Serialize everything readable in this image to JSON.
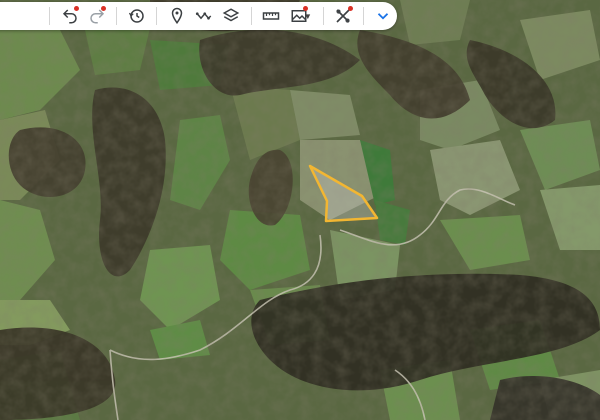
{
  "colors": {
    "boundary": "#f2b632",
    "accent_dot": "#d93025",
    "toolbar_bg": "#ffffff",
    "icon": "#3c4043",
    "expand_icon": "#1a73e8"
  },
  "toolbar": {
    "icons": [
      "undo-icon",
      "redo-icon",
      "history-icon",
      "add-placemark-icon",
      "add-path-icon",
      "layers-icon",
      "measure-ruler-icon",
      "add-photo-icon",
      "settings-tools-icon",
      "expand-icon"
    ]
  },
  "map": {
    "type": "satellite",
    "selected_boundary": "polygon"
  }
}
